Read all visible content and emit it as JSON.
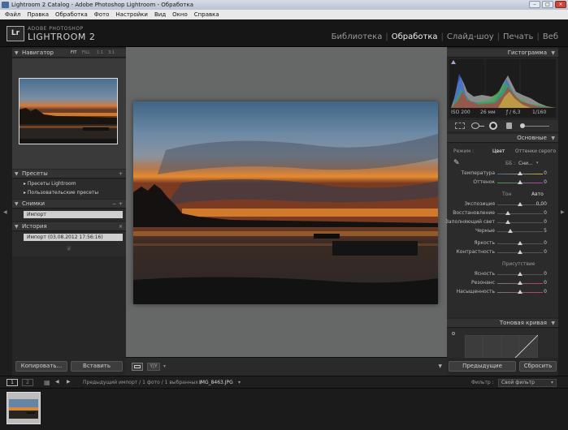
{
  "window": {
    "title": "Lightroom 2 Catalog - Adobe Photoshop Lightroom - Обработка"
  },
  "menu": [
    "Файл",
    "Правка",
    "Обработка",
    "Фото",
    "Настройки",
    "Вид",
    "Окно",
    "Справка"
  ],
  "identity": {
    "adobe": "ADOBE PHOTOSHOP",
    "product": "LIGHTROOM 2",
    "logo": "Lr"
  },
  "modules": [
    {
      "label": "Библиотека",
      "active": false
    },
    {
      "label": "Обработка",
      "active": true
    },
    {
      "label": "Слайд-шоу",
      "active": false
    },
    {
      "label": "Печать",
      "active": false
    },
    {
      "label": "Веб",
      "active": false
    }
  ],
  "left": {
    "navigator": {
      "title": "Навигатор",
      "zoom": [
        "FIT",
        "FILL",
        "1:1",
        "3:1"
      ]
    },
    "presets": {
      "title": "Пресеты",
      "add": "+",
      "items": [
        "Пресеты Lightroom",
        "Пользовательские пресеты"
      ]
    },
    "snapshots": {
      "title": "Снимки",
      "add": "+",
      "minus": "−",
      "items": [
        "Импорт"
      ]
    },
    "history": {
      "title": "История",
      "close": "×",
      "items": [
        "Импорт (03.08.2012 17:56:16)"
      ]
    },
    "buttons": {
      "copy": "Копировать...",
      "paste": "Вставить"
    }
  },
  "right": {
    "histogram": {
      "title": "Гистограмма",
      "info": {
        "iso": "ISO 200",
        "focal": "26 мм",
        "aperture": "ƒ / 6,3",
        "shutter": "1/160"
      }
    },
    "basic": {
      "title": "Основные",
      "treatment_label": "Режим :",
      "treatment_color": "Цвет",
      "treatment_gray": "Оттенки серого",
      "wb_label": "ББ :",
      "wb_value": "Сни...",
      "wb_sliders": [
        {
          "label": "Температура",
          "value": "0"
        },
        {
          "label": "Оттенок",
          "value": "0"
        }
      ],
      "tone_label": "Тон",
      "tone_auto": "Авто",
      "tone_sliders": [
        {
          "label": "Экспозиция",
          "value": "0,00"
        },
        {
          "label": "Восстановление",
          "value": "0"
        },
        {
          "label": "Заполняющий свет",
          "value": "0"
        },
        {
          "label": "Черные",
          "value": "5"
        },
        {
          "label": "Яркость",
          "value": "0"
        },
        {
          "label": "Контрастность",
          "value": "0"
        }
      ],
      "presence_label": "Присутствие",
      "presence_sliders": [
        {
          "label": "Ясность",
          "value": "0"
        },
        {
          "label": "Резонанс",
          "value": "0"
        },
        {
          "label": "Насыщенность",
          "value": "0"
        }
      ]
    },
    "tone_curve": {
      "title": "Тоновая кривая"
    },
    "buttons": {
      "previous": "Предыдущие",
      "reset": "Сбросить"
    }
  },
  "filmbar": {
    "page1": "1",
    "page2": "2",
    "path": "Предыдущий импорт / 1 фото / 1 выбранных /",
    "filename": "IMG_8463.JPG",
    "filter_label": "Фильтр :",
    "filter_value": "Свой фильтр"
  },
  "colors": {
    "accent": "#e0e0e0",
    "panel": "#262626",
    "center": "#666767"
  }
}
